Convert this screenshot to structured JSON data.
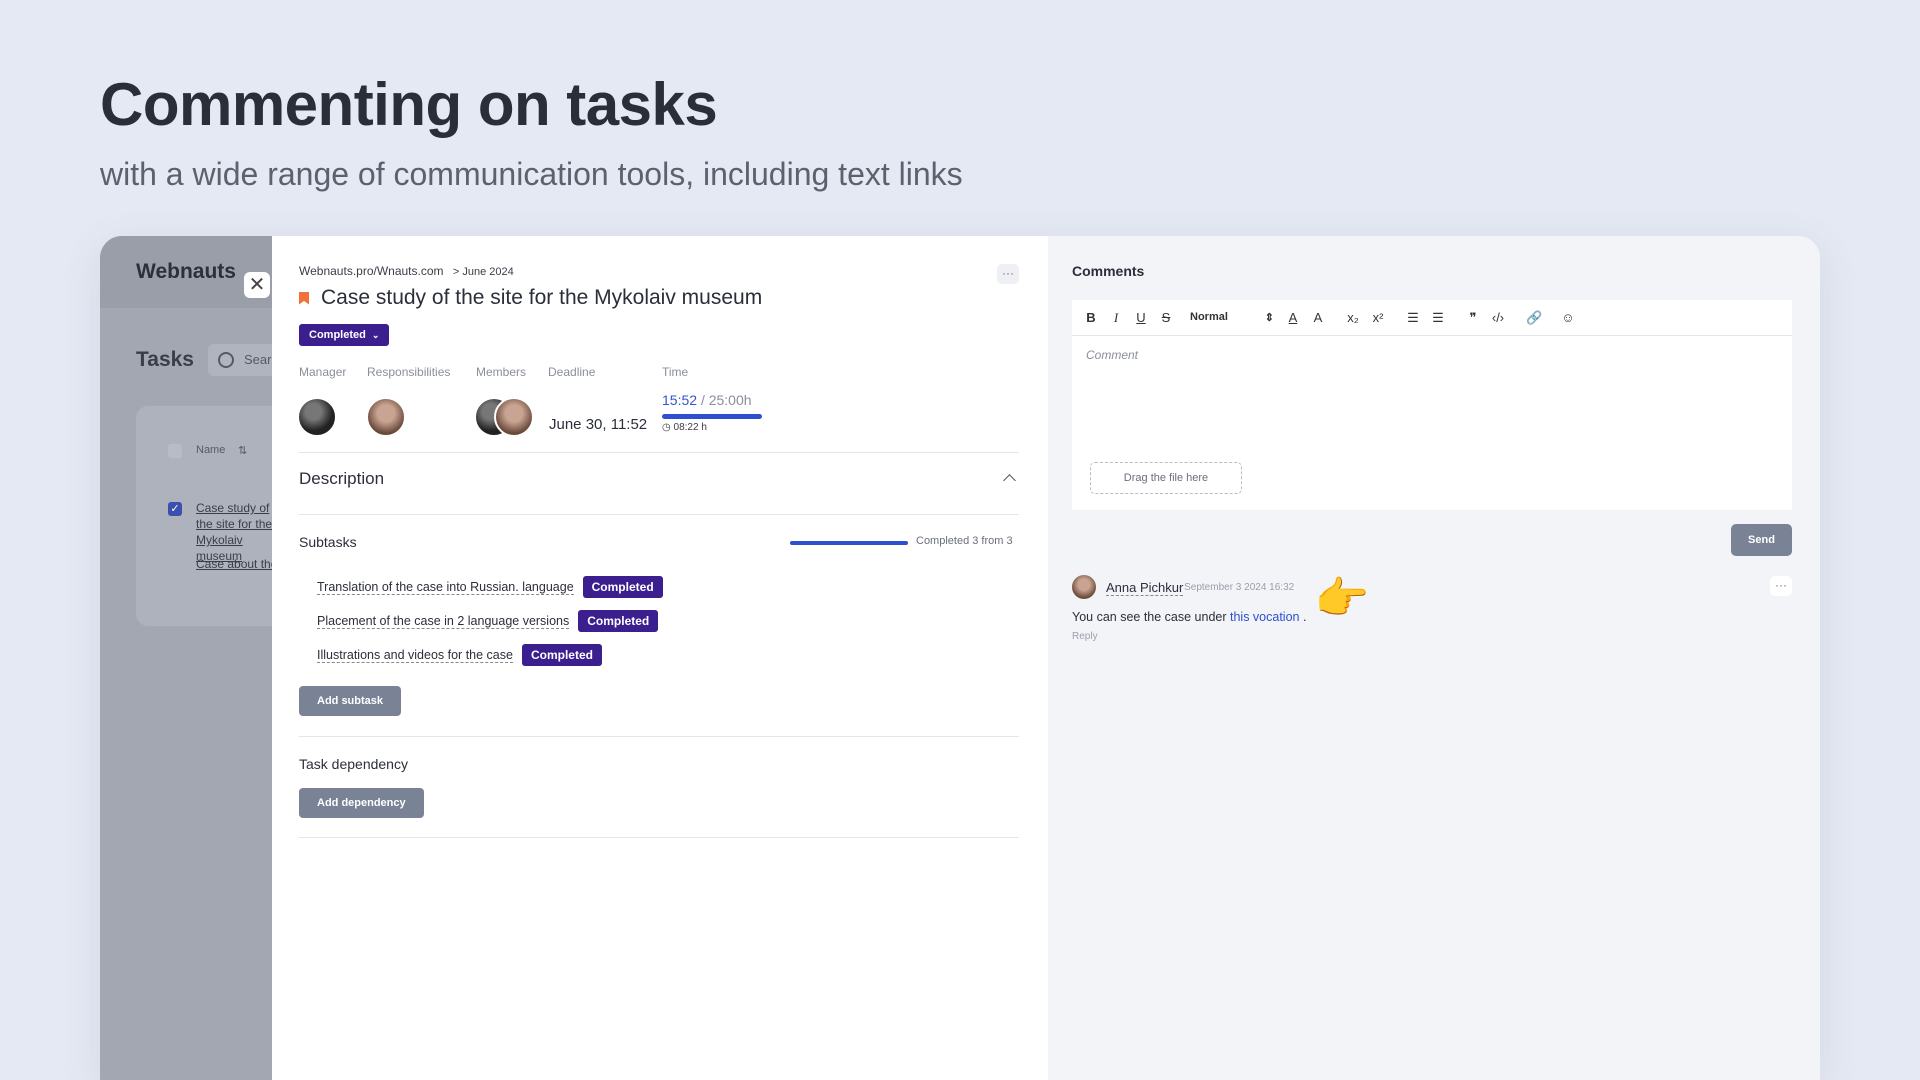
{
  "hero": {
    "title": "Commenting on tasks",
    "subtitle": "with a wide range of communication tools, including text links"
  },
  "background_app": {
    "brand": "Webnauts",
    "section": "Tasks",
    "search_placeholder": "Search",
    "table_header": "Name",
    "rows": [
      "Case study of the site for the Mykolaiv museum",
      "Case about the"
    ]
  },
  "task": {
    "breadcrumb": "Webnauts.pro/Wnauts.com",
    "breadcrumb_date": "> June 2024",
    "title": "Case study of the site for the Mykolaiv museum",
    "status": "Completed",
    "meta_labels": {
      "manager": "Manager",
      "responsibilities": "Responsibilities",
      "members": "Members",
      "deadline": "Deadline",
      "time": "Time"
    },
    "deadline": "June 30, 11:52",
    "time_spent": "15:52",
    "time_total": "/ 25:00h",
    "time_sub": "08:22 h",
    "description_title": "Description",
    "subtasks_title": "Subtasks",
    "subtasks_progress": "Completed 3 from 3",
    "subtasks": [
      {
        "label": "Translation of the case into Russian. language",
        "status": "Completed"
      },
      {
        "label": "Placement of the case in 2 language versions",
        "status": "Completed"
      },
      {
        "label": "Illustrations and videos for the case",
        "status": "Completed"
      }
    ],
    "add_subtask": "Add subtask",
    "dependency_title": "Task dependency",
    "add_dependency": "Add dependency",
    "more": "···"
  },
  "comments": {
    "title": "Comments",
    "toolbar": {
      "bold": "B",
      "italic": "I",
      "underline": "U",
      "strike": "S",
      "format": "Normal",
      "format_arrows": "⇕",
      "color": "A",
      "highlight": "A",
      "sub": "x₂",
      "sup": "x²",
      "ol": "☰",
      "ul": "☰",
      "quote": "❞",
      "code": "‹/›",
      "link": "🔗",
      "emoji": "☺"
    },
    "placeholder": "Comment",
    "dropzone": "Drag the file here",
    "send": "Send",
    "entry": {
      "author": "Anna Pichkur",
      "date": "· September 3 2024 16:32",
      "text_before": "You can see the case under ",
      "link": "this vocation",
      "text_after": " .",
      "reply": "Reply",
      "more": "···"
    }
  }
}
